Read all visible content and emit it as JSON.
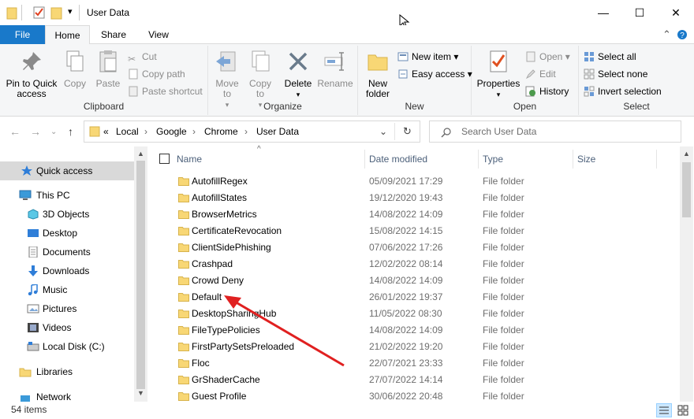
{
  "window": {
    "title": "User Data",
    "minimize": "—",
    "maximize": "☐",
    "close": "✕",
    "dropdown": "▾"
  },
  "tabs": {
    "file": "File",
    "home": "Home",
    "share": "Share",
    "view": "View"
  },
  "ribbon": {
    "clipboard": {
      "label": "Clipboard",
      "pin": "Pin to Quick access",
      "copy": "Copy",
      "paste": "Paste",
      "cut": "Cut",
      "copy_path": "Copy path",
      "paste_shortcut": "Paste shortcut"
    },
    "organize": {
      "label": "Organize",
      "move_to": "Move to",
      "copy_to": "Copy to",
      "delete": "Delete",
      "rename": "Rename"
    },
    "new": {
      "label": "New",
      "new_folder": "New folder",
      "new_item": "New item",
      "easy_access": "Easy access"
    },
    "open": {
      "label": "Open",
      "properties": "Properties",
      "open": "Open",
      "edit": "Edit",
      "history": "History"
    },
    "select": {
      "label": "Select",
      "select_all": "Select all",
      "select_none": "Select none",
      "invert": "Invert selection"
    }
  },
  "address": {
    "prefix": "«",
    "crumbs": [
      "Local",
      "Google",
      "Chrome",
      "User Data"
    ],
    "search_placeholder": "Search User Data"
  },
  "nav": [
    {
      "label": "Quick access",
      "icon": "star-icon"
    },
    {
      "label": "This PC",
      "icon": "pc-icon"
    },
    {
      "label": "3D Objects",
      "icon": "3d-objects-icon"
    },
    {
      "label": "Desktop",
      "icon": "desktop-icon"
    },
    {
      "label": "Documents",
      "icon": "documents-icon"
    },
    {
      "label": "Downloads",
      "icon": "downloads-icon"
    },
    {
      "label": "Music",
      "icon": "music-icon"
    },
    {
      "label": "Pictures",
      "icon": "pictures-icon"
    },
    {
      "label": "Videos",
      "icon": "videos-icon"
    },
    {
      "label": "Local Disk (C:)",
      "icon": "disk-icon"
    },
    {
      "label": "Libraries",
      "icon": "libraries-icon"
    },
    {
      "label": "Network",
      "icon": "network-icon"
    }
  ],
  "columns": {
    "name": "Name",
    "date": "Date modified",
    "type": "Type",
    "size": "Size"
  },
  "files": [
    {
      "name": "AutofillRegex",
      "date": "05/09/2021 17:29",
      "type": "File folder"
    },
    {
      "name": "AutofillStates",
      "date": "19/12/2020 19:43",
      "type": "File folder"
    },
    {
      "name": "BrowserMetrics",
      "date": "14/08/2022 14:09",
      "type": "File folder"
    },
    {
      "name": "CertificateRevocation",
      "date": "15/08/2022 14:15",
      "type": "File folder"
    },
    {
      "name": "ClientSidePhishing",
      "date": "07/06/2022 17:26",
      "type": "File folder"
    },
    {
      "name": "Crashpad",
      "date": "12/02/2022 08:14",
      "type": "File folder"
    },
    {
      "name": "Crowd Deny",
      "date": "14/08/2022 14:09",
      "type": "File folder"
    },
    {
      "name": "Default",
      "date": "26/01/2022 19:37",
      "type": "File folder"
    },
    {
      "name": "DesktopSharingHub",
      "date": "11/05/2022 08:30",
      "type": "File folder"
    },
    {
      "name": "FileTypePolicies",
      "date": "14/08/2022 14:09",
      "type": "File folder"
    },
    {
      "name": "FirstPartySetsPreloaded",
      "date": "21/02/2022 19:20",
      "type": "File folder"
    },
    {
      "name": "Floc",
      "date": "22/07/2021 23:33",
      "type": "File folder"
    },
    {
      "name": "GrShaderCache",
      "date": "27/07/2022 14:14",
      "type": "File folder"
    },
    {
      "name": "Guest Profile",
      "date": "30/06/2022 20:48",
      "type": "File folder"
    }
  ],
  "status": {
    "count": "54 items"
  },
  "colors": {
    "accent": "#1979ca",
    "folder": "#f8d775",
    "arrow": "#e02020"
  }
}
